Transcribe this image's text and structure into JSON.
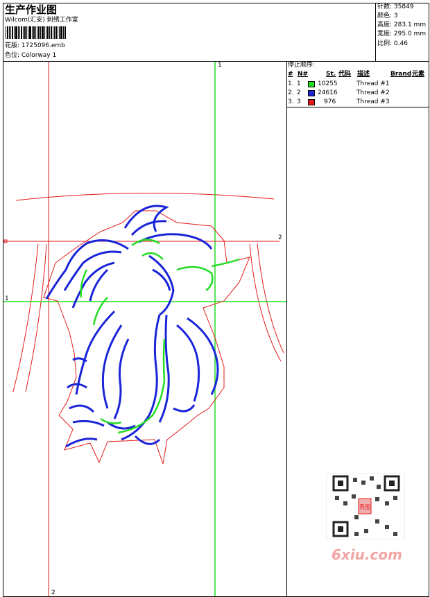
{
  "header": {
    "title": "生产作业图",
    "company": "Wilcom(汇安) 刺绣工作室",
    "design_label": "花版:",
    "design_value": "1725096.emb",
    "color_label": "色位:",
    "color_value": "Colorway 1"
  },
  "stats": {
    "stitches_label": "针数:",
    "stitches_value": "35849",
    "colors_label": "颜色:",
    "colors_value": "3",
    "height_label": "高度:",
    "height_value": "283.1 mm",
    "width_label": "宽度:",
    "width_value": "295.0 mm",
    "scale_label": "比例:",
    "scale_value": "0.46"
  },
  "sequence": {
    "title": "停止顺序:",
    "headers": [
      "#",
      "N#",
      "St.",
      "代码",
      "描述",
      "Brand",
      "元素"
    ],
    "rows": [
      {
        "index": "1.",
        "n": "1",
        "color": "#22dd22",
        "stitches": "10255",
        "desc": "Thread #1"
      },
      {
        "index": "2.",
        "n": "2",
        "color": "#1a24d8",
        "stitches": "24616",
        "desc": "Thread #2"
      },
      {
        "index": "3.",
        "n": "3",
        "color": "#e61a1a",
        "stitches": "976",
        "desc": "Thread #3"
      }
    ]
  },
  "guides": {
    "green_top": "1",
    "red_right": "2",
    "green_left": "1",
    "red_bottom": "2"
  },
  "watermark": {
    "text": "6xiu.com",
    "stamp": "秀图"
  },
  "colors": {
    "green": "#22dd22",
    "blue": "#1a24d8",
    "red": "#e61a1a"
  }
}
